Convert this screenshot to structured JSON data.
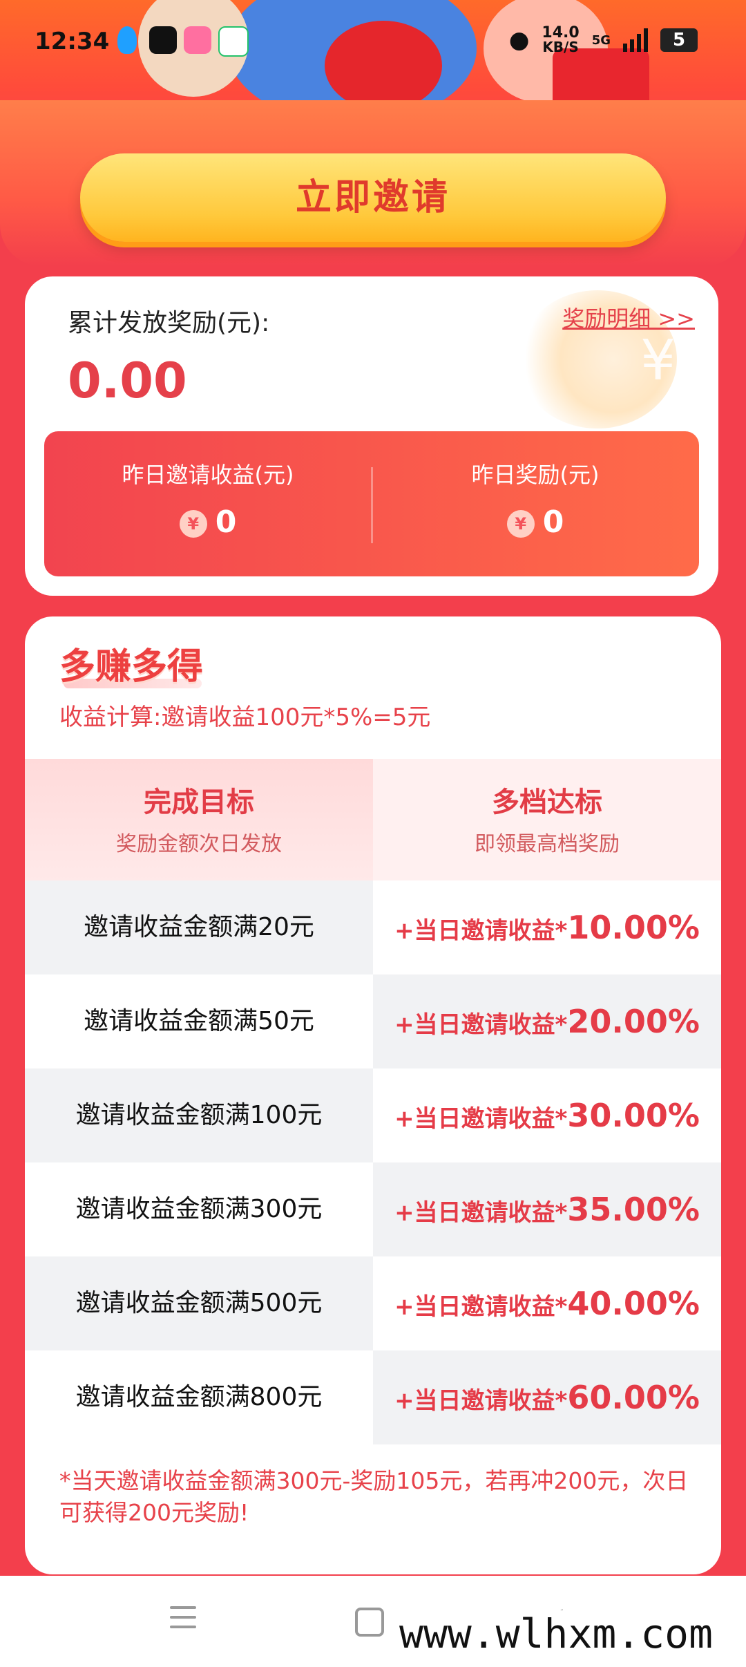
{
  "status_bar": {
    "time": "12:34",
    "net_rate": "14.0",
    "net_unit": "KB/S",
    "signal": "5G",
    "battery": "5"
  },
  "invite_button": "立即邀请",
  "rewards": {
    "label": "累计发放奖励(元):",
    "detail_link": "奖励明细 >>",
    "amount": "0.00",
    "yesterday_invite_label": "昨日邀请收益(元)",
    "yesterday_invite_value": "0",
    "yesterday_reward_label": "昨日奖励(元)",
    "yesterday_reward_value": "0",
    "currency_symbol": "¥"
  },
  "earn_more": {
    "title": "多赚多得",
    "calc": "收益计算:邀请收益100元*5%=5元",
    "header_left_title": "完成目标",
    "header_left_sub": "奖励金额次日发放",
    "header_right_title": "多档达标",
    "header_right_sub": "即领最高档奖励",
    "rows": [
      {
        "target": "邀请收益金额满20元",
        "prefix": "+当日邀请收益*",
        "pct": "10.00%"
      },
      {
        "target": "邀请收益金额满50元",
        "prefix": "+当日邀请收益*",
        "pct": "20.00%"
      },
      {
        "target": "邀请收益金额满100元",
        "prefix": "+当日邀请收益*",
        "pct": "30.00%"
      },
      {
        "target": "邀请收益金额满300元",
        "prefix": "+当日邀请收益*",
        "pct": "35.00%"
      },
      {
        "target": "邀请收益金额满500元",
        "prefix": "+当日邀请收益*",
        "pct": "40.00%"
      },
      {
        "target": "邀请收益金额满800元",
        "prefix": "+当日邀请收益*",
        "pct": "60.00%"
      }
    ],
    "note": "*当天邀请收益金额满300元-奖励105元，若再冲200元，次日可获得200元奖励!"
  },
  "watermark": "www.wlhxm.com",
  "colors": {
    "primary_red": "#f33f4c",
    "accent_red": "#e5404a",
    "button_yellow": "#ffc93c"
  }
}
